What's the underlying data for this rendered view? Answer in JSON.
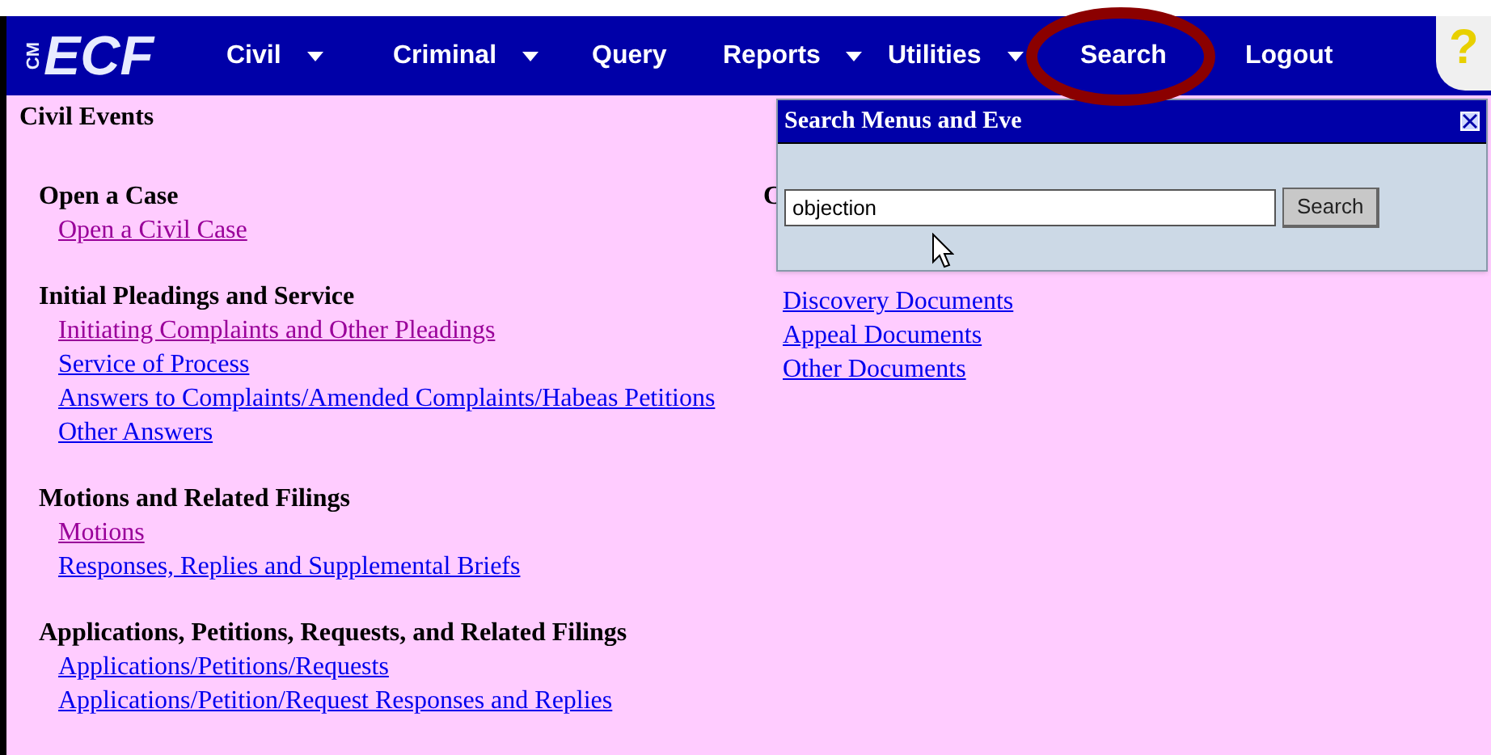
{
  "logo": {
    "prefix": "CM",
    "name": "ECF"
  },
  "menu": [
    {
      "label": "Civil",
      "dropdown": true
    },
    {
      "label": "Criminal",
      "dropdown": true
    },
    {
      "label": "Query",
      "dropdown": false
    },
    {
      "label": "Reports",
      "dropdown": true
    },
    {
      "label": "Utilities",
      "dropdown": true
    },
    {
      "label": "Search",
      "dropdown": false
    },
    {
      "label": "Logout",
      "dropdown": false
    }
  ],
  "help_icon": {
    "label": "?"
  },
  "annotation": {
    "kind": "ellipse"
  },
  "page_title": "Civil Events",
  "left_column": [
    {
      "heading": "Open a Case",
      "links": [
        {
          "label": "Open a Civil Case",
          "visited": true
        }
      ]
    },
    {
      "heading": "Initial Pleadings and Service",
      "links": [
        {
          "label": "Initiating Complaints and Other Pleadings",
          "visited": true
        },
        {
          "label": "Service of Process",
          "visited": false
        },
        {
          "label": "Answers to Complaints/Amended Complaints/Habeas Petitions",
          "visited": false
        },
        {
          "label": "Other Answers",
          "visited": false
        }
      ]
    },
    {
      "heading": "Motions and Related Filings",
      "links": [
        {
          "label": "Motions",
          "visited": true
        },
        {
          "label": "Responses, Replies and Supplemental Briefs",
          "visited": false
        }
      ]
    },
    {
      "heading": "Applications, Petitions, Requests, and Related Filings",
      "links": [
        {
          "label": "Applications/Petitions/Requests",
          "visited": false
        },
        {
          "label": "Applications/Petition/Request Responses and Replies",
          "visited": false
        }
      ]
    }
  ],
  "right_column": {
    "heading": "C",
    "links": [
      {
        "label": "Discovery Documents",
        "visited": false
      },
      {
        "label": "Appeal Documents",
        "visited": false
      },
      {
        "label": "Other Documents",
        "visited": false
      }
    ]
  },
  "search_dialog": {
    "title": "Search Menus and Eve",
    "value": "objection",
    "button": "Search"
  }
}
